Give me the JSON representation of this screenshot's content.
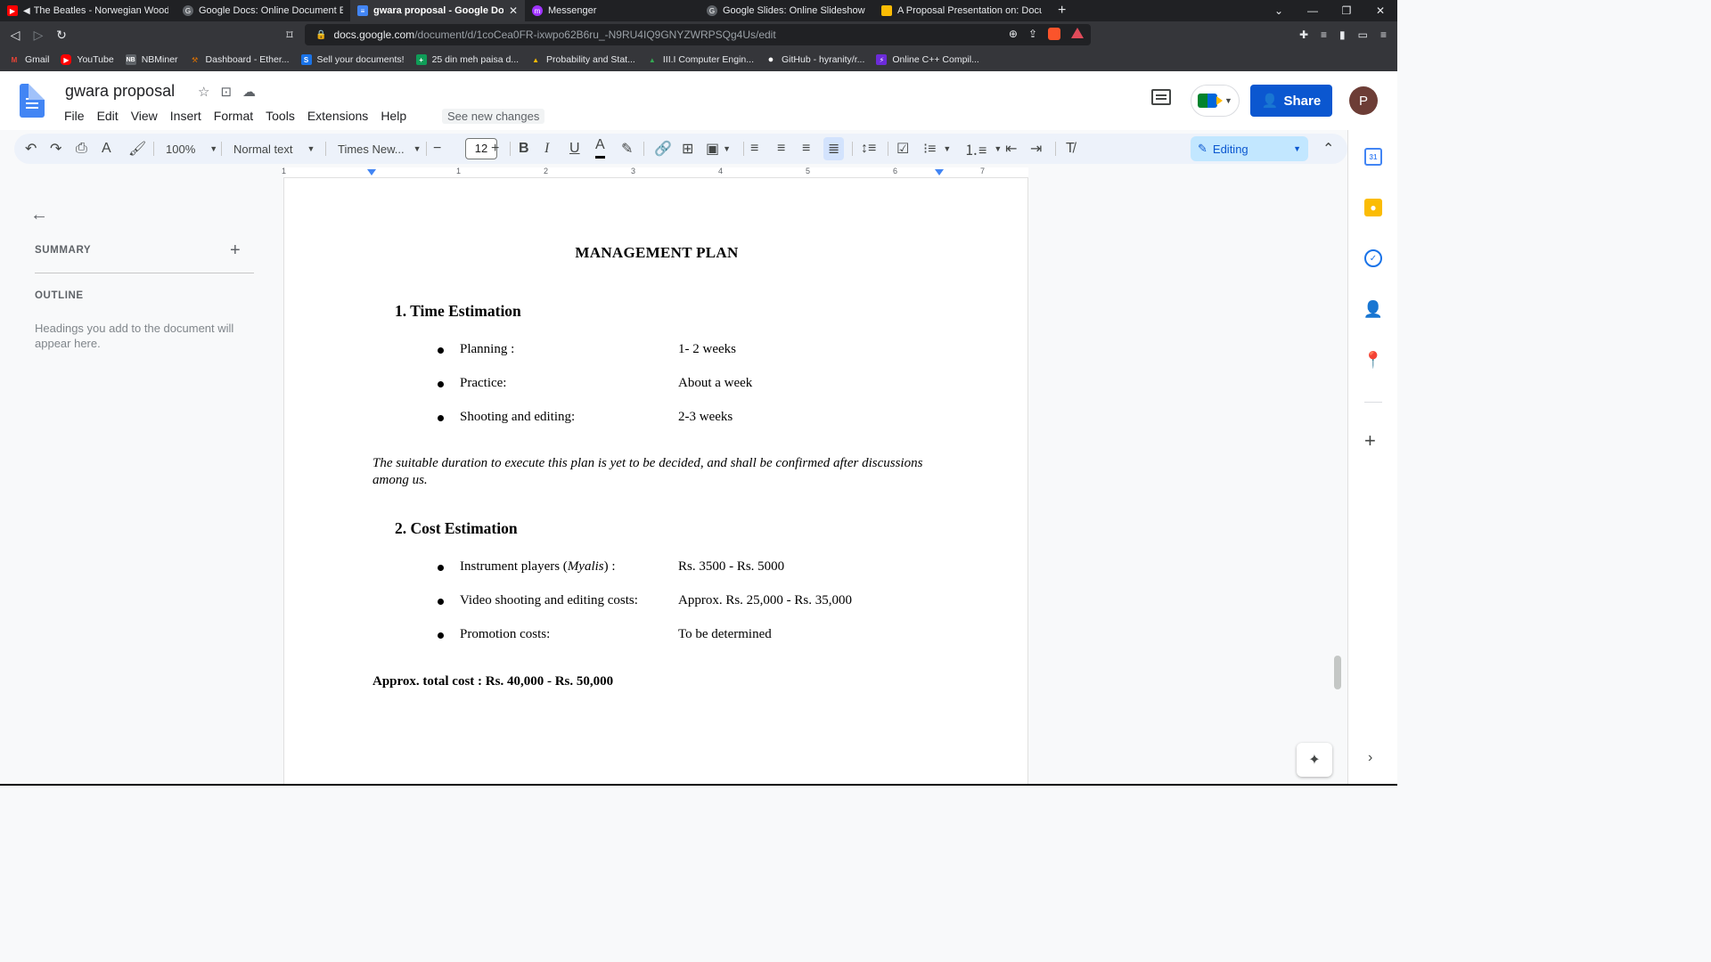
{
  "browser": {
    "tabs": [
      {
        "title": "The Beatles - Norwegian Wood (Th",
        "favicon_color": "#ff0000",
        "favicon": "▶"
      },
      {
        "title": "Google Docs: Online Document Editor",
        "favicon_color": "#5f6368",
        "favicon": "G"
      },
      {
        "title": "gwara proposal - Google Docs",
        "favicon_color": "#4285f4",
        "favicon": "≡",
        "active": true
      },
      {
        "title": "Messenger",
        "favicon_color": "#a033ff",
        "favicon": "m"
      },
      {
        "title": "Google Slides: Online Slideshow Maker",
        "favicon_color": "#5f6368",
        "favicon": "G"
      },
      {
        "title": "A Proposal Presentation on: Document",
        "favicon_color": "#fbbc04",
        "favicon": "■"
      }
    ],
    "new_tab": "+",
    "url_host": "docs.google.com",
    "url_path": "/document/d/1coCea0FR-ixwpo62B6ru_-N9RU4IQ9GNYZWRPSQg4Us/edit",
    "bookmarks": [
      {
        "label": "Gmail",
        "color": "#ea4335",
        "icon": "M"
      },
      {
        "label": "YouTube",
        "color": "#ff0000",
        "icon": "▶"
      },
      {
        "label": "NBMiner",
        "color": "#5f6368",
        "icon": "NB"
      },
      {
        "label": "Dashboard - Ether...",
        "color": "#e37400",
        "icon": "⚒"
      },
      {
        "label": "Sell your documents!",
        "color": "#1a73e8",
        "icon": "S"
      },
      {
        "label": "25 din meh paisa d...",
        "color": "#0f9d58",
        "icon": "+"
      },
      {
        "label": "Probability and Stat...",
        "color": "#fbbc04",
        "icon": "▲"
      },
      {
        "label": "III.I Computer Engin...",
        "color": "#34a853",
        "icon": "▲"
      },
      {
        "label": "GitHub - hyranity/r...",
        "color": "#ffffff",
        "icon": "●"
      },
      {
        "label": "Online C++ Compil...",
        "color": "#6c2bd9",
        "icon": "⚡"
      }
    ]
  },
  "docs": {
    "title": "gwara proposal",
    "menu": [
      "File",
      "Edit",
      "View",
      "Insert",
      "Format",
      "Tools",
      "Extensions",
      "Help"
    ],
    "see_new_changes": "See new changes",
    "share_label": "Share",
    "avatar_letter": "P",
    "toolbar": {
      "zoom": "100%",
      "style": "Normal text",
      "font": "Times New...",
      "font_size": "12",
      "mode": "Editing"
    },
    "ruler_numbers": [
      "1",
      "1",
      "2",
      "3",
      "4",
      "5",
      "6",
      "7"
    ]
  },
  "outline_panel": {
    "summary_label": "SUMMARY",
    "outline_label": "OUTLINE",
    "outline_hint": "Headings you add to the document will appear here."
  },
  "document": {
    "title": "MANAGEMENT PLAN",
    "section1": {
      "heading": "1.  Time Estimation",
      "items": [
        {
          "label": "Planning :",
          "value": "1- 2 weeks"
        },
        {
          "label": "Practice:",
          "value": "About a week"
        },
        {
          "label": "Shooting and editing:",
          "value": "2-3 weeks"
        }
      ],
      "note": "The suitable duration to execute this plan is yet to be decided, and shall be confirmed after discussions among us."
    },
    "section2": {
      "heading": "2.  Cost Estimation",
      "items": [
        {
          "label_pre": "Instrument players (",
          "label_italic": "Myalis",
          "label_post": ") :",
          "value": "Rs. 3500 - Rs. 5000"
        },
        {
          "label": "Video shooting and editing costs:",
          "value": "Approx. Rs. 25,000 - Rs. 35,000"
        },
        {
          "label": "Promotion costs:",
          "value": "To be determined"
        }
      ]
    },
    "total": "Approx. total cost :   Rs. 40,000 - Rs. 50,000"
  },
  "side_panel": {
    "calendar_day": "31"
  }
}
